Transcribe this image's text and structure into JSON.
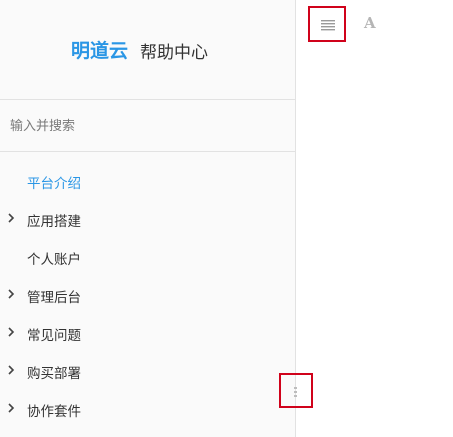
{
  "sidebar": {
    "logo": {
      "brand": "明道云",
      "title": "帮助中心"
    },
    "search": {
      "placeholder": "输入并搜索"
    },
    "items": [
      {
        "label": "平台介绍",
        "has_children": false,
        "active": true
      },
      {
        "label": "应用搭建",
        "has_children": true,
        "active": false
      },
      {
        "label": "个人账户",
        "has_children": false,
        "active": false
      },
      {
        "label": "管理后台",
        "has_children": true,
        "active": false
      },
      {
        "label": "常见问题",
        "has_children": true,
        "active": false
      },
      {
        "label": "购买部署",
        "has_children": true,
        "active": false
      },
      {
        "label": "协作套件",
        "has_children": true,
        "active": false
      }
    ]
  },
  "toolbar": {
    "menu_icon": "hamburger-icon",
    "font_label": "A"
  },
  "colors": {
    "accent": "#2a96e5",
    "highlight_border": "#d0021b",
    "sidebar_bg": "#fafafa"
  }
}
